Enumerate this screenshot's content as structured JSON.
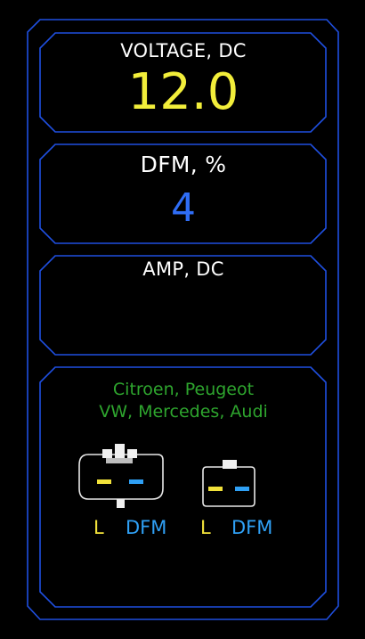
{
  "colors": {
    "frame": "#1f4fe0",
    "label": "#ffffff",
    "voltage_value": "#f2ee3a",
    "dfm_value": "#2f6df5",
    "brands": "#2ea52e",
    "pin_l": "#f2e23a",
    "pin_dfm": "#2fa0f5"
  },
  "voltage": {
    "label": "VOLTAGE, DC",
    "value": "12.0"
  },
  "dfm": {
    "label": "DFM, %",
    "value": "4"
  },
  "amp": {
    "label": "AMP, DC",
    "value": ""
  },
  "connectors": {
    "brands_line1": "Citroen, Peugeot",
    "brands_line2": "VW, Mercedes, Audi",
    "left": {
      "pin_l": "L",
      "pin_dfm": "DFM"
    },
    "right": {
      "pin_l": "L",
      "pin_dfm": "DFM"
    }
  }
}
